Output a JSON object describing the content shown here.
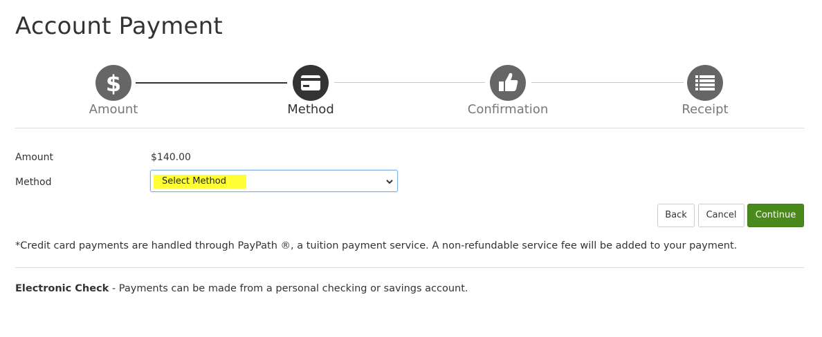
{
  "page": {
    "title": "Account Payment"
  },
  "steps": [
    {
      "label": "Amount",
      "icon": "dollar-icon",
      "state": "done"
    },
    {
      "label": "Method",
      "icon": "credit-card-icon",
      "state": "active"
    },
    {
      "label": "Confirmation",
      "icon": "thumbs-up-icon",
      "state": "todo"
    },
    {
      "label": "Receipt",
      "icon": "list-icon",
      "state": "todo"
    }
  ],
  "form": {
    "amount_label": "Amount",
    "amount_value": "$140.00",
    "method_label": "Method",
    "method_selected": "Select Method"
  },
  "buttons": {
    "back": "Back",
    "cancel": "Cancel",
    "continue": "Continue"
  },
  "notes": {
    "credit_card": "*Credit card payments are handled through PayPath ®, a tuition payment service. A non-refundable service fee will be added to your payment.",
    "echeck_title": "Electronic Check",
    "echeck_text": " - Payments can be made from a personal checking or savings account."
  },
  "colors": {
    "primary_button": "#4a8a1c",
    "step_active": "#333333",
    "step_inactive": "#666666",
    "highlight": "#ffff33"
  }
}
